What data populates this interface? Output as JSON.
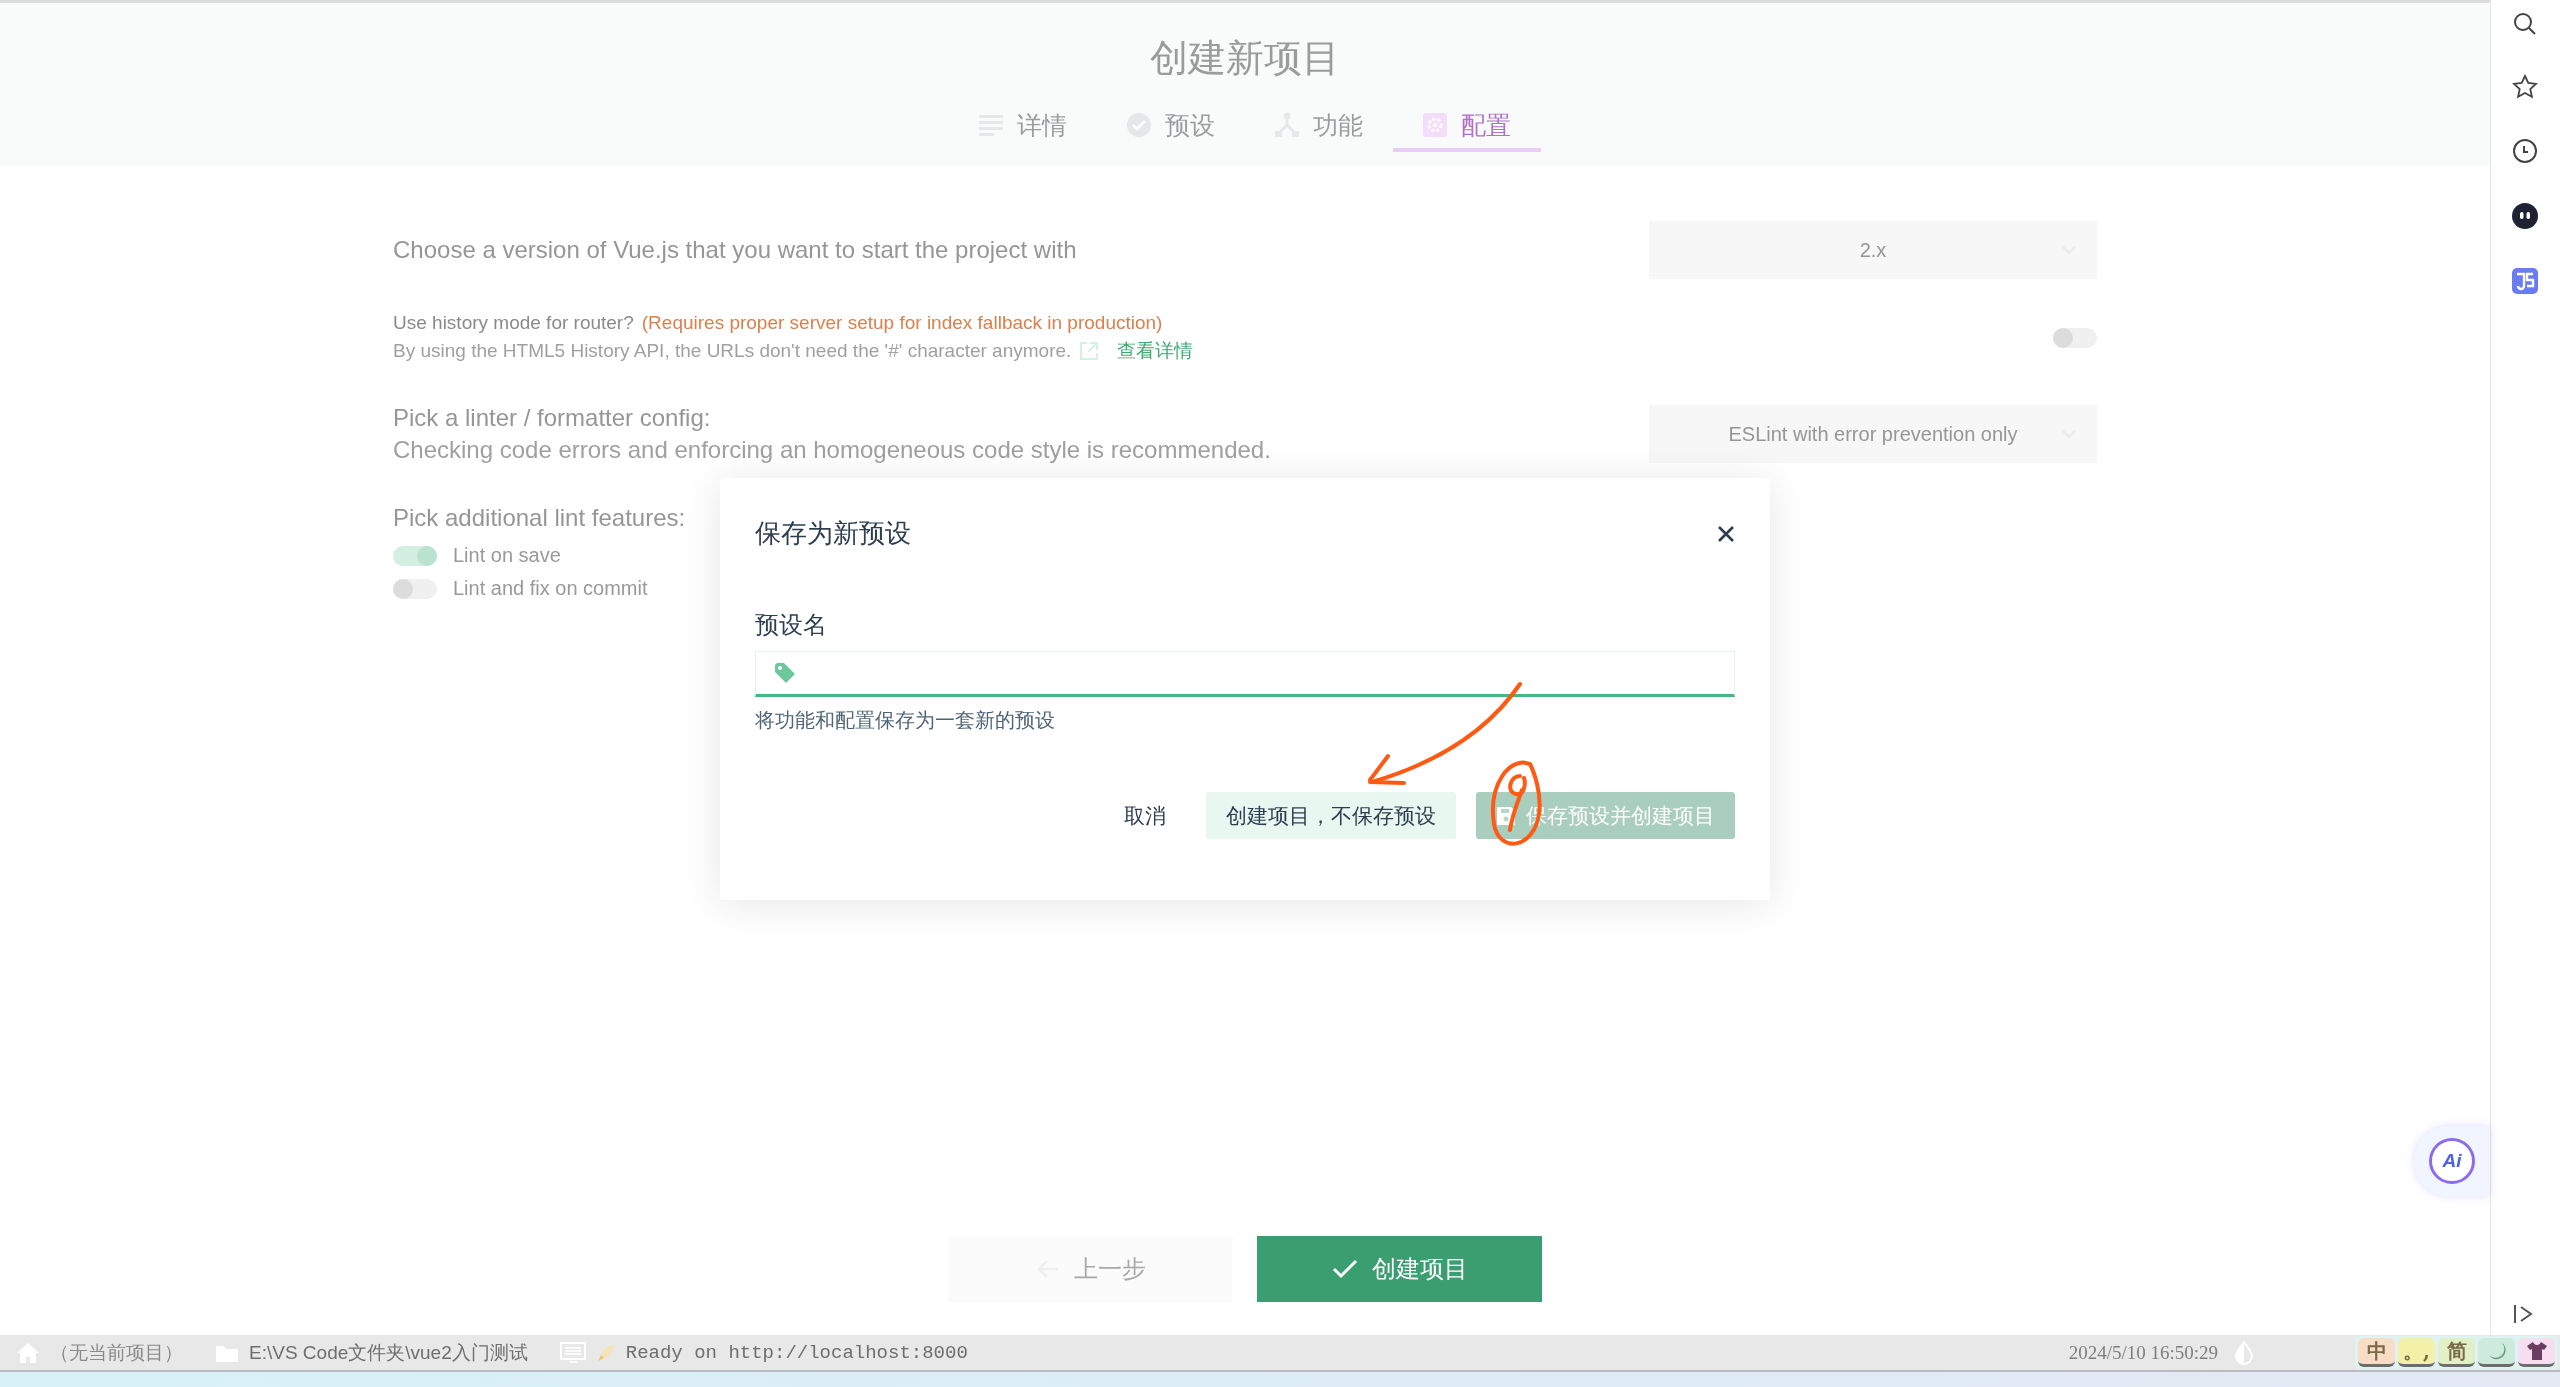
{
  "page": {
    "title": "创建新项目"
  },
  "tabs": [
    {
      "label": "详情",
      "kind": "list",
      "selected": false
    },
    {
      "label": "预设",
      "kind": "check",
      "selected": false
    },
    {
      "label": "功能",
      "kind": "fork",
      "selected": false
    },
    {
      "label": "配置",
      "kind": "gear",
      "selected": true
    }
  ],
  "settings": [
    {
      "kind": "select",
      "label": "Choose a version of Vue.js that you want to start the project with",
      "value": "2.x"
    },
    {
      "kind": "switch",
      "label": "Use history mode for router?",
      "warning": "(Requires proper server setup for index fallback in production)",
      "description": "By using the HTML5 History API, the URLs don't need the '#' character anymore.",
      "link": "查看详情",
      "on": false
    },
    {
      "kind": "select",
      "label": "Pick a linter / formatter config:",
      "description": "Checking code errors and enforcing an homogeneous code style is recommended.",
      "value": "ESLint with error prevention only"
    },
    {
      "kind": "checklist",
      "label": "Pick additional lint features:",
      "options": [
        {
          "label": "Lint on save",
          "on": true
        },
        {
          "label": "Lint and fix on commit",
          "on": false
        }
      ]
    }
  ],
  "footer_buttons": [
    {
      "label": "上一步",
      "kind": "back",
      "disabled": true
    },
    {
      "label": "创建项目",
      "kind": "create",
      "disabled": false
    }
  ],
  "dialog": {
    "title": "保存为新预设",
    "field_label": "预设名",
    "hint": "将功能和配置保存为一套新的预设",
    "buttons": [
      {
        "label": "取消",
        "kind": "flat",
        "disabled": false
      },
      {
        "label": "创建项目，不保存预设",
        "kind": "secondary",
        "disabled": false
      },
      {
        "label": "保存预设并创建项目",
        "kind": "primary",
        "disabled": true
      }
    ]
  },
  "ai_button": {
    "label": "Ai"
  },
  "status_bar": {
    "project": "（无当前项目）",
    "folder": "E:\\VS Code文件夹\\vue2入门测试",
    "log": "Ready on http://localhost:8000",
    "clock": "2024/5/10 16:50:29"
  },
  "ime_bar": [
    {
      "kind": "text",
      "label": "中",
      "color": "#f7dcc6"
    },
    {
      "kind": "text",
      "label": "。,",
      "color": "#f3f0a8"
    },
    {
      "kind": "text",
      "label": "简",
      "color": "#e2f0c8"
    },
    {
      "kind": "moon",
      "color": "#cdebdc"
    },
    {
      "kind": "shirt",
      "color": "#f6def0"
    }
  ]
}
